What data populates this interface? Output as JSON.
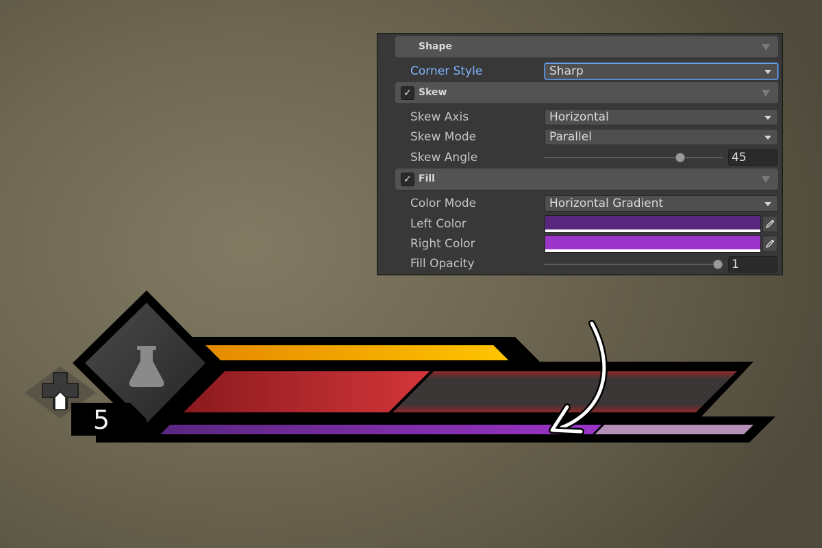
{
  "inspector": {
    "shape": {
      "title": "Shape",
      "corner_style_label": "Corner Style",
      "corner_style_value": "Sharp"
    },
    "skew": {
      "title": "Skew",
      "enabled": true,
      "axis_label": "Skew Axis",
      "axis_value": "Horizontal",
      "mode_label": "Skew Mode",
      "mode_value": "Parallel",
      "angle_label": "Skew Angle",
      "angle_value": "45",
      "angle_slider_fraction": 0.76
    },
    "fill": {
      "title": "Fill",
      "enabled": true,
      "color_mode_label": "Color Mode",
      "color_mode_value": "Horizontal Gradient",
      "left_color_label": "Left Color",
      "left_color": "#5a2780",
      "right_color_label": "Right Color",
      "right_color": "#9b34c8",
      "opacity_label": "Fill Opacity",
      "opacity_value": "1",
      "opacity_slider_fraction": 1.0
    }
  },
  "hud": {
    "level": "5",
    "ability_icon": "flask-icon",
    "controller_icon": "dpad-icon",
    "energy_fill_fraction": 0.93,
    "health_fill_fraction": 0.4,
    "mana_fill_fraction": 0.74,
    "colors": {
      "energy": "#f2a200",
      "health": "#b82428",
      "mana_left": "#5a2780",
      "mana_right": "#9b34c8",
      "mana_empty": "#b48fb8",
      "health_empty": "#3a3a3a"
    }
  }
}
